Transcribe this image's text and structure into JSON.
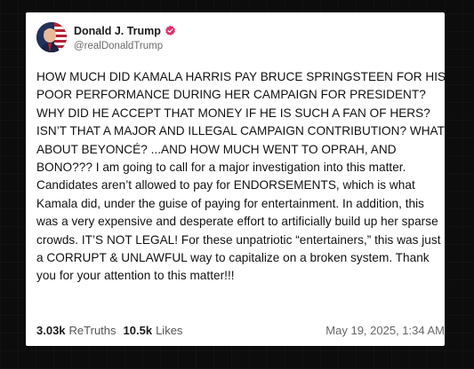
{
  "post": {
    "display_name": "Donald J. Trump",
    "handle": "@realDonaldTrump",
    "verified_icon": "verified-badge-icon",
    "accent_color": "#e0306e",
    "text": "HOW MUCH DID KAMALA HARRIS PAY BRUCE SPRINGSTEEN FOR HIS POOR PERFORMANCE DURING HER CAMPAIGN FOR PRESIDENT? WHY DID HE ACCEPT THAT MONEY IF HE IS SUCH A FAN OF HERS? ISN’T THAT A MAJOR AND ILLEGAL CAMPAIGN CONTRIBUTION? WHAT ABOUT BEYONCÉ? ...AND HOW MUCH WENT TO OPRAH, AND BONO??? I am going to call for a major investigation into this matter. Candidates aren’t allowed to pay for ENDORSEMENTS, which is what Kamala did, under the guise of paying for entertainment. In addition, this was a very expensive and desperate effort to artificially build up her sparse crowds. IT’S NOT LEGAL! For these unpatriotic “entertainers,” this was just a CORRUPT & UNLAWFUL way to capitalize on a broken system. Thank you for your attention to this matter!!!"
  },
  "stats": {
    "retruths_count": "3.03k",
    "retruths_label": "ReTruths",
    "likes_count": "10.5k",
    "likes_label": "Likes"
  },
  "timestamp": "May 19, 2025, 1:34 AM"
}
